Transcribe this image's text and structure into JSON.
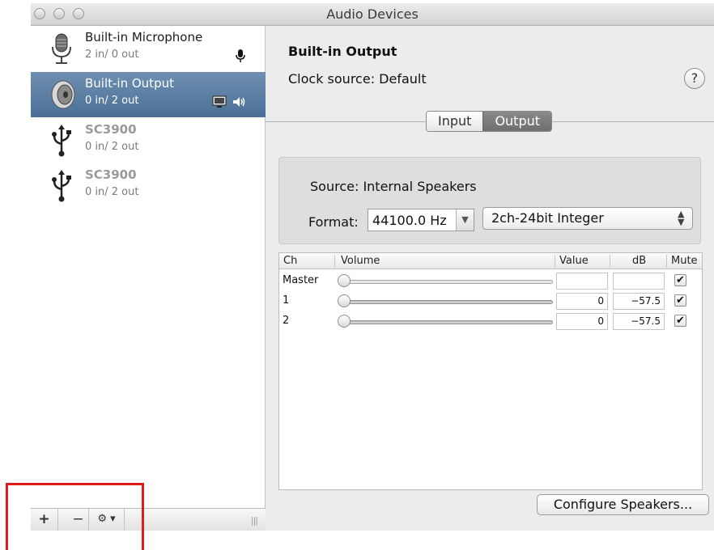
{
  "window": {
    "title": "Audio Devices"
  },
  "devices": [
    {
      "name": "Built-in Microphone",
      "io": "2 in/ 0 out",
      "icon": "microphone-icon",
      "badge": "mic-badge-icon"
    },
    {
      "name": "Built-in Output",
      "io": "0 in/ 2 out",
      "icon": "speaker-icon",
      "badge": "speaker-badge-icon",
      "selected": true
    },
    {
      "name": "SC3900",
      "io": "0 in/ 2 out",
      "icon": "usb-icon"
    },
    {
      "name": "SC3900",
      "io": "0 in/ 2 out",
      "icon": "usb-icon"
    }
  ],
  "bottombar": {
    "add": "+",
    "remove": "−",
    "gear": "⚙ ▾",
    "grip": "|||"
  },
  "detail": {
    "title": "Built-in Output",
    "clock_label": "Clock source:",
    "clock_value": "Default",
    "help": "?",
    "tabs": [
      {
        "label": "Input"
      },
      {
        "label": "Output",
        "active": true
      }
    ],
    "source_label": "Source:",
    "source_value": "Internal Speakers",
    "format_label": "Format:",
    "sample_rate": "44100.0 Hz",
    "combo_arrow": "▼",
    "bit_format": "2ch-24bit Integer",
    "popup_arrow": "▲▼"
  },
  "table": {
    "headers": {
      "ch": "Ch",
      "volume": "Volume",
      "value": "Value",
      "db": "dB",
      "mute": "Mute"
    },
    "rows": [
      {
        "ch": "Master",
        "value": "",
        "db": "",
        "muted": true,
        "check": "✔"
      },
      {
        "ch": "1",
        "value": "0",
        "db": "−57.5",
        "muted": true,
        "check": "✔"
      },
      {
        "ch": "2",
        "value": "0",
        "db": "−57.5",
        "muted": true,
        "check": "✔"
      }
    ]
  },
  "configure_button": "Configure Speakers...",
  "colors": {
    "selection": "#5a7da3",
    "highlight": "#e01b1b"
  }
}
